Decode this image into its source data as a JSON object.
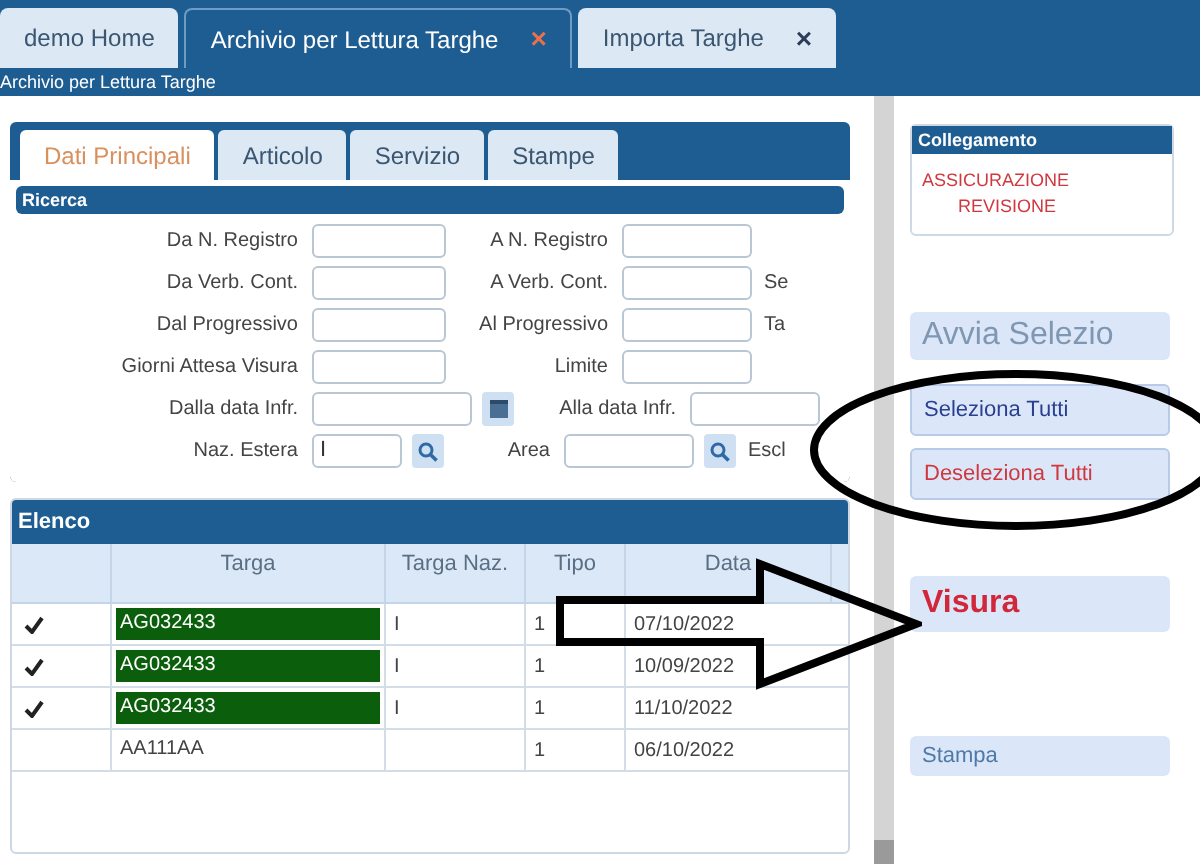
{
  "window_tabs": [
    {
      "label": "demo Home",
      "selected": false
    },
    {
      "label": "Archivio per Lettura Targhe",
      "selected": true,
      "close": "×"
    },
    {
      "label": "Importa Targhe",
      "selected": false,
      "close": "×"
    }
  ],
  "breadcrumb": "Archivio per Lettura Targhe",
  "form_tabs": [
    {
      "label": "Dati Principali",
      "selected": true
    },
    {
      "label": "Articolo",
      "selected": false
    },
    {
      "label": "Servizio",
      "selected": false
    },
    {
      "label": "Stampe",
      "selected": false
    }
  ],
  "search_panel": {
    "title": "Ricerca",
    "rows": [
      {
        "cells": [
          {
            "kind": "field",
            "label": "Da N. Registro"
          },
          {
            "kind": "field",
            "label": "A N. Registro"
          }
        ]
      },
      {
        "cells": [
          {
            "kind": "field",
            "label": "Da Verb. Cont."
          },
          {
            "kind": "field",
            "label": "A Verb. Cont."
          },
          {
            "kind": "label",
            "label": "Se"
          }
        ]
      },
      {
        "cells": [
          {
            "kind": "field",
            "label": "Dal Progressivo"
          },
          {
            "kind": "field",
            "label": "Al Progressivo"
          },
          {
            "kind": "label",
            "label": "Ta"
          }
        ]
      },
      {
        "cells": [
          {
            "kind": "field",
            "label": "Giorni Attesa Visura"
          },
          {
            "kind": "field",
            "label": "Limite"
          }
        ]
      },
      {
        "cells": [
          {
            "kind": "date_field",
            "label": "Dalla data Infr."
          },
          {
            "kind": "field",
            "label": "Alla data Infr."
          }
        ]
      },
      {
        "cells": [
          {
            "kind": "lookup_field",
            "label": "Naz. Estera",
            "value": "I"
          },
          {
            "kind": "lookup_field",
            "label": "Area"
          },
          {
            "kind": "label",
            "label": "Escl"
          }
        ]
      }
    ]
  },
  "list_panel": {
    "title": "Elenco",
    "columns": [
      "Targa",
      "Targa Naz.",
      "Tipo",
      "Data"
    ],
    "rows": [
      {
        "checked": true,
        "highlighted": true,
        "targa": "AG032433",
        "targa_naz": "I",
        "tipo": "1",
        "data": "07/10/2022"
      },
      {
        "checked": true,
        "highlighted": true,
        "targa": "AG032433",
        "targa_naz": "I",
        "tipo": "1",
        "data": "10/09/2022"
      },
      {
        "checked": true,
        "highlighted": true,
        "targa": "AG032433",
        "targa_naz": "I",
        "tipo": "1",
        "data": "11/10/2022"
      },
      {
        "checked": false,
        "highlighted": false,
        "targa": "AA111AA",
        "tipo": "1",
        "data": "06/10/2022"
      }
    ]
  },
  "sidebar": {
    "link_panel": {
      "title": "Collegamento",
      "links": [
        "ASSICURAZIONE",
        "REVISIONE"
      ]
    },
    "buttons": [
      {
        "label": "Avvia Selezio",
        "kind": "large"
      },
      {
        "label": "Seleziona Tutti",
        "kind": "select"
      },
      {
        "label": "Deseleziona Tutti",
        "kind": "deselect"
      },
      {
        "label": "Visura",
        "kind": "primary"
      },
      {
        "label": "Stampa",
        "kind": "plain"
      }
    ]
  }
}
